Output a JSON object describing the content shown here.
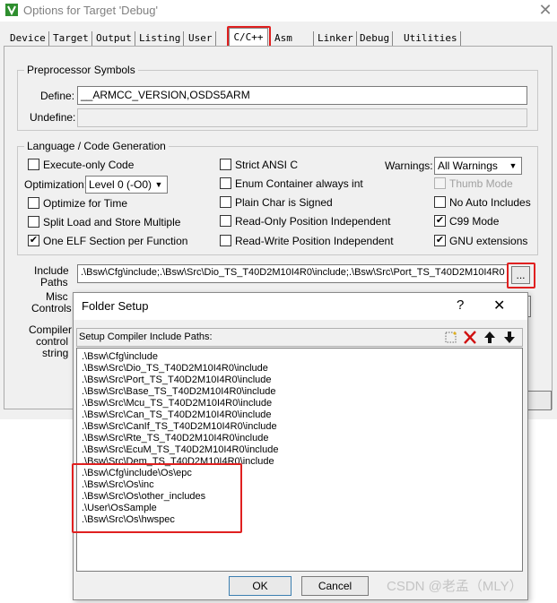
{
  "window": {
    "title": "Options for Target 'Debug'",
    "close_glyph": "✕"
  },
  "tabs": [
    {
      "label": "Device"
    },
    {
      "label": "Target"
    },
    {
      "label": "Output"
    },
    {
      "label": "Listing"
    },
    {
      "label": "User"
    },
    {
      "label": "C/C++"
    },
    {
      "label": "Asm"
    },
    {
      "label": "Linker"
    },
    {
      "label": "Debug"
    },
    {
      "label": "Utilities"
    }
  ],
  "active_tab": "C/C++",
  "preprocessor": {
    "title": "Preprocessor Symbols",
    "define_label": "Define:",
    "define_value": "__ARMCC_VERSION,OSDS5ARM",
    "undefine_label": "Undefine:",
    "undefine_value": ""
  },
  "codegen": {
    "title": "Language / Code Generation",
    "options": {
      "execute_only": {
        "label": "Execute-only Code",
        "checked": false
      },
      "optimize_time": {
        "label": "Optimize for Time",
        "checked": false
      },
      "split_load": {
        "label": "Split Load and Store Multiple",
        "checked": false
      },
      "one_elf": {
        "label": "One ELF Section per Function",
        "checked": true
      },
      "strict_ansi": {
        "label": "Strict ANSI C",
        "checked": false
      },
      "enum_container": {
        "label": "Enum Container always int",
        "checked": false
      },
      "plain_char": {
        "label": "Plain Char is Signed",
        "checked": false
      },
      "ro_pi": {
        "label": "Read-Only Position Independent",
        "checked": false
      },
      "rw_pi": {
        "label": "Read-Write Position Independent",
        "checked": false
      },
      "thumb_mode": {
        "label": "Thumb Mode",
        "checked": false,
        "disabled": true
      },
      "no_auto_includes": {
        "label": "No Auto Includes",
        "checked": false
      },
      "c99_mode": {
        "label": "C99 Mode",
        "checked": true
      },
      "gnu_extensions": {
        "label": "GNU extensions",
        "checked": true
      }
    },
    "optimization_label": "Optimization:",
    "optimization_value": "Level 0 (-O0)",
    "warnings_label": "Warnings:",
    "warnings_value": "All Warnings"
  },
  "include": {
    "label_line1": "Include",
    "label_line2": "Paths",
    "value": ".\\Bsw\\Cfg\\include;.\\Bsw\\Src\\Dio_TS_T40D2M10I4R0\\include;.\\Bsw\\Src\\Port_TS_T40D2M10I4R0",
    "browse_label": "..."
  },
  "misc": {
    "line1": "Misc",
    "line2": "Controls"
  },
  "compiler_string": {
    "line1": "Compiler",
    "line2": "control",
    "line3": "string"
  },
  "folder_dialog": {
    "title": "Folder Setup",
    "help_glyph": "?",
    "close_glyph": "✕",
    "list_header": "Setup Compiler Include Paths:",
    "paths": [
      ".\\Bsw\\Cfg\\include",
      ".\\Bsw\\Src\\Dio_TS_T40D2M10I4R0\\include",
      ".\\Bsw\\Src\\Port_TS_T40D2M10I4R0\\include",
      ".\\Bsw\\Src\\Base_TS_T40D2M10I4R0\\include",
      ".\\Bsw\\Src\\Mcu_TS_T40D2M10I4R0\\include",
      ".\\Bsw\\Src\\Can_TS_T40D2M10I4R0\\include",
      ".\\Bsw\\Src\\CanIf_TS_T40D2M10I4R0\\include",
      ".\\Bsw\\Src\\Rte_TS_T40D2M10I4R0\\include",
      ".\\Bsw\\Src\\EcuM_TS_T40D2M10I4R0\\include",
      ".\\Bsw\\Src\\Dem_TS_T40D2M10I4R0\\include",
      ".\\Bsw\\Cfg\\include\\Os\\epc",
      ".\\Bsw\\Src\\Os\\inc",
      ".\\Bsw\\Src\\Os\\other_includes",
      ".\\User\\OsSample",
      ".\\Bsw\\Src\\Os\\hwspec"
    ],
    "ok_label": "OK",
    "cancel_label": "Cancel",
    "tool_icons": [
      "new-folder-icon",
      "delete-icon",
      "move-up-icon",
      "move-down-icon"
    ]
  },
  "watermark": "CSDN @老孟（MLY）",
  "colors": {
    "highlight": "#e02020",
    "delete_red": "#d01010",
    "dialog_bg": "#f0f0f0"
  }
}
